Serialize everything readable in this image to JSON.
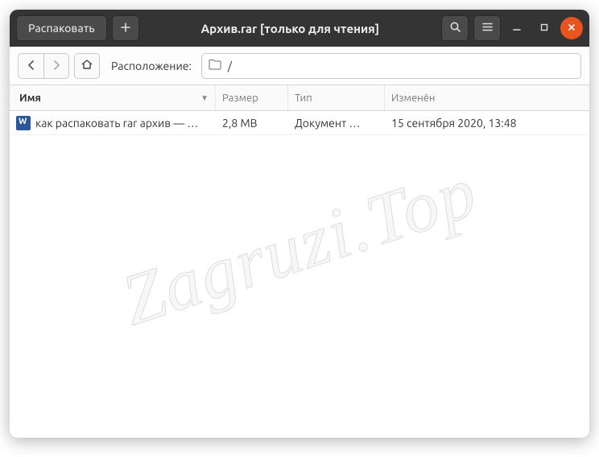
{
  "titlebar": {
    "extract_label": "Распаковать",
    "title": "Архив.rar [только для чтения]"
  },
  "locationbar": {
    "label": "Расположение:",
    "path": "/"
  },
  "columns": {
    "name": "Имя",
    "size": "Размер",
    "type": "Тип",
    "modified": "Изменён"
  },
  "rows": [
    {
      "name": "как распаковать rar архив — …",
      "size": "2,8 MB",
      "type": "Документ …",
      "modified": "15 сентября 2020, 13:48"
    }
  ],
  "watermark": "Zagruzi.Top"
}
